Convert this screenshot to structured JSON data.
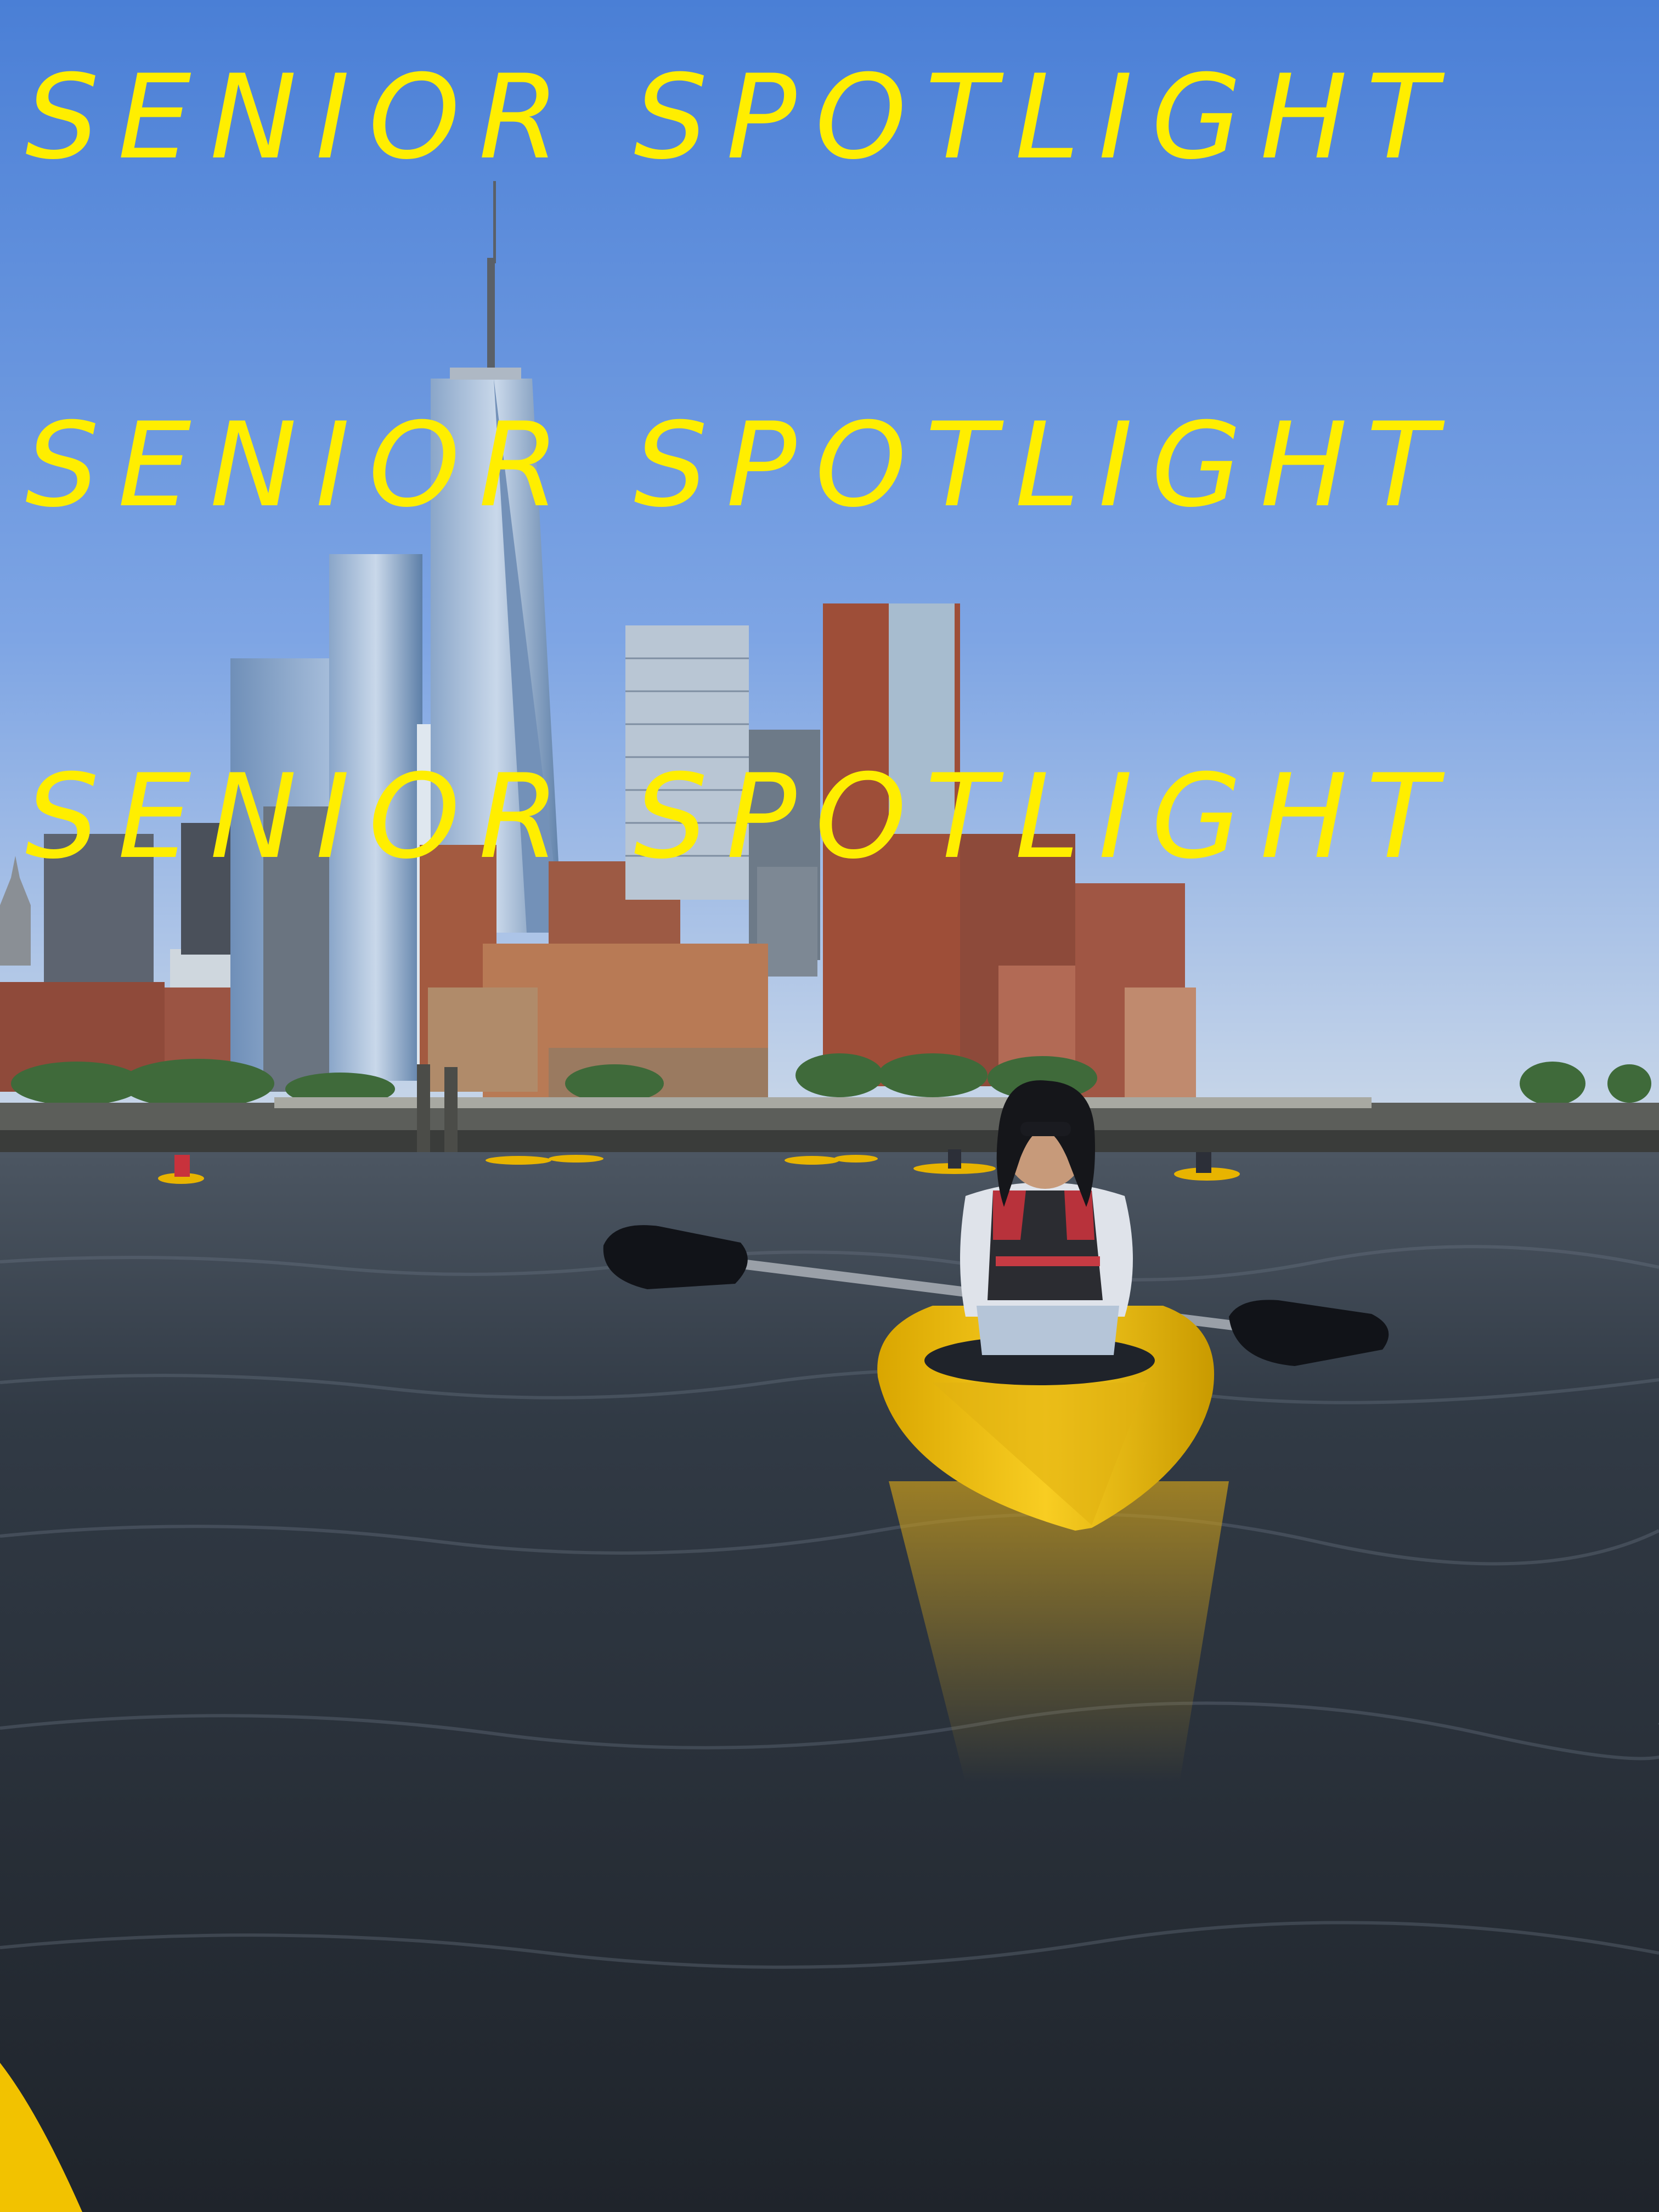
{
  "overlay_text": {
    "line_1": "SENIOR SPOTLIGHT",
    "line_2": "SENIOR SPOTLIGHT",
    "line_3": "SENIOR SPOTLIGHT"
  },
  "colors": {
    "overlay_text": "#ffee00",
    "sky_top": "#4a7fd6",
    "sky_bottom": "#cfdbe9",
    "water": "#2a3038",
    "kayak": "#f5c518"
  }
}
